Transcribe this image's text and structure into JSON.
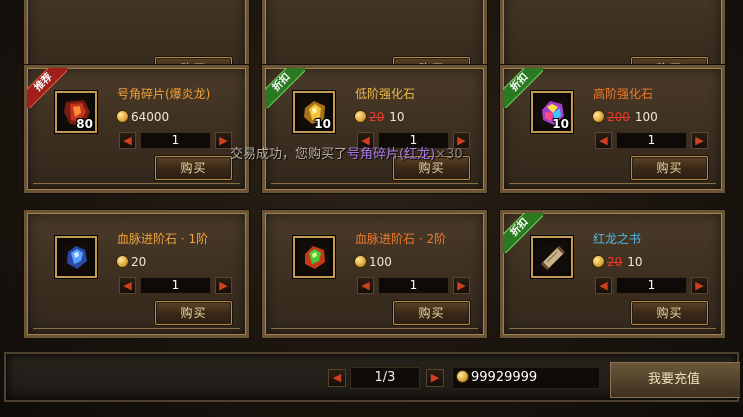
{
  "common": {
    "buy_label": "购买"
  },
  "toast": {
    "part1": "交易成功，您购买了",
    "item": "号角碎片(红龙)",
    "count": "×30"
  },
  "cards": [
    {
      "tag": "",
      "name": "",
      "name_color": "",
      "qty_badge": "",
      "price_old": "",
      "price": "",
      "quantity": "",
      "gem": ""
    },
    {
      "tag": "",
      "name": "",
      "name_color": "",
      "qty_badge": "",
      "price_old": "",
      "price": "",
      "quantity": "",
      "gem": ""
    },
    {
      "tag": "",
      "name": "",
      "name_color": "",
      "qty_badge": "",
      "price_old": "",
      "price": "",
      "quantity": "",
      "gem": ""
    },
    {
      "tag": "推荐",
      "tag_type": "red",
      "name": "号角碎片(爆炎龙)",
      "name_color": "#f0a23c",
      "qty_badge": "80",
      "price_old": "",
      "price": "64000",
      "quantity": "1",
      "gem": "dragon-horn-fragment-icon"
    },
    {
      "tag": "折扣",
      "tag_type": "green",
      "name": "低阶强化石",
      "name_color": "#f0b84a",
      "qty_badge": "10",
      "price_old": "20",
      "price": "10",
      "quantity": "1",
      "gem": "gold-stone-icon"
    },
    {
      "tag": "折扣",
      "tag_type": "green",
      "name": "高阶强化石",
      "name_color": "#f07a2a",
      "qty_badge": "10",
      "price_old": "200",
      "price": "100",
      "quantity": "1",
      "gem": "rainbow-stone-icon"
    },
    {
      "tag": "",
      "name": "血脉进阶石 · 1阶",
      "name_color": "#f0a23c",
      "qty_badge": "",
      "price_old": "",
      "price": "20",
      "quantity": "1",
      "gem": "blue-crystal-icon"
    },
    {
      "tag": "",
      "name": "血脉进阶石 · 2阶",
      "name_color": "#f07a2a",
      "qty_badge": "",
      "price_old": "",
      "price": "100",
      "quantity": "1",
      "gem": "green-red-crystal-icon"
    },
    {
      "tag": "折扣",
      "tag_type": "green",
      "name": "红龙之书",
      "name_color": "#4fb8e8",
      "qty_badge": "",
      "price_old": "20",
      "price": "10",
      "quantity": "1",
      "gem": "scroll-icon"
    }
  ],
  "pager": {
    "prev_symbol": "◀",
    "next_symbol": "▶",
    "text": "1/3"
  },
  "gold": {
    "amount": "99929999"
  },
  "recharge": {
    "label": "我要充值"
  }
}
